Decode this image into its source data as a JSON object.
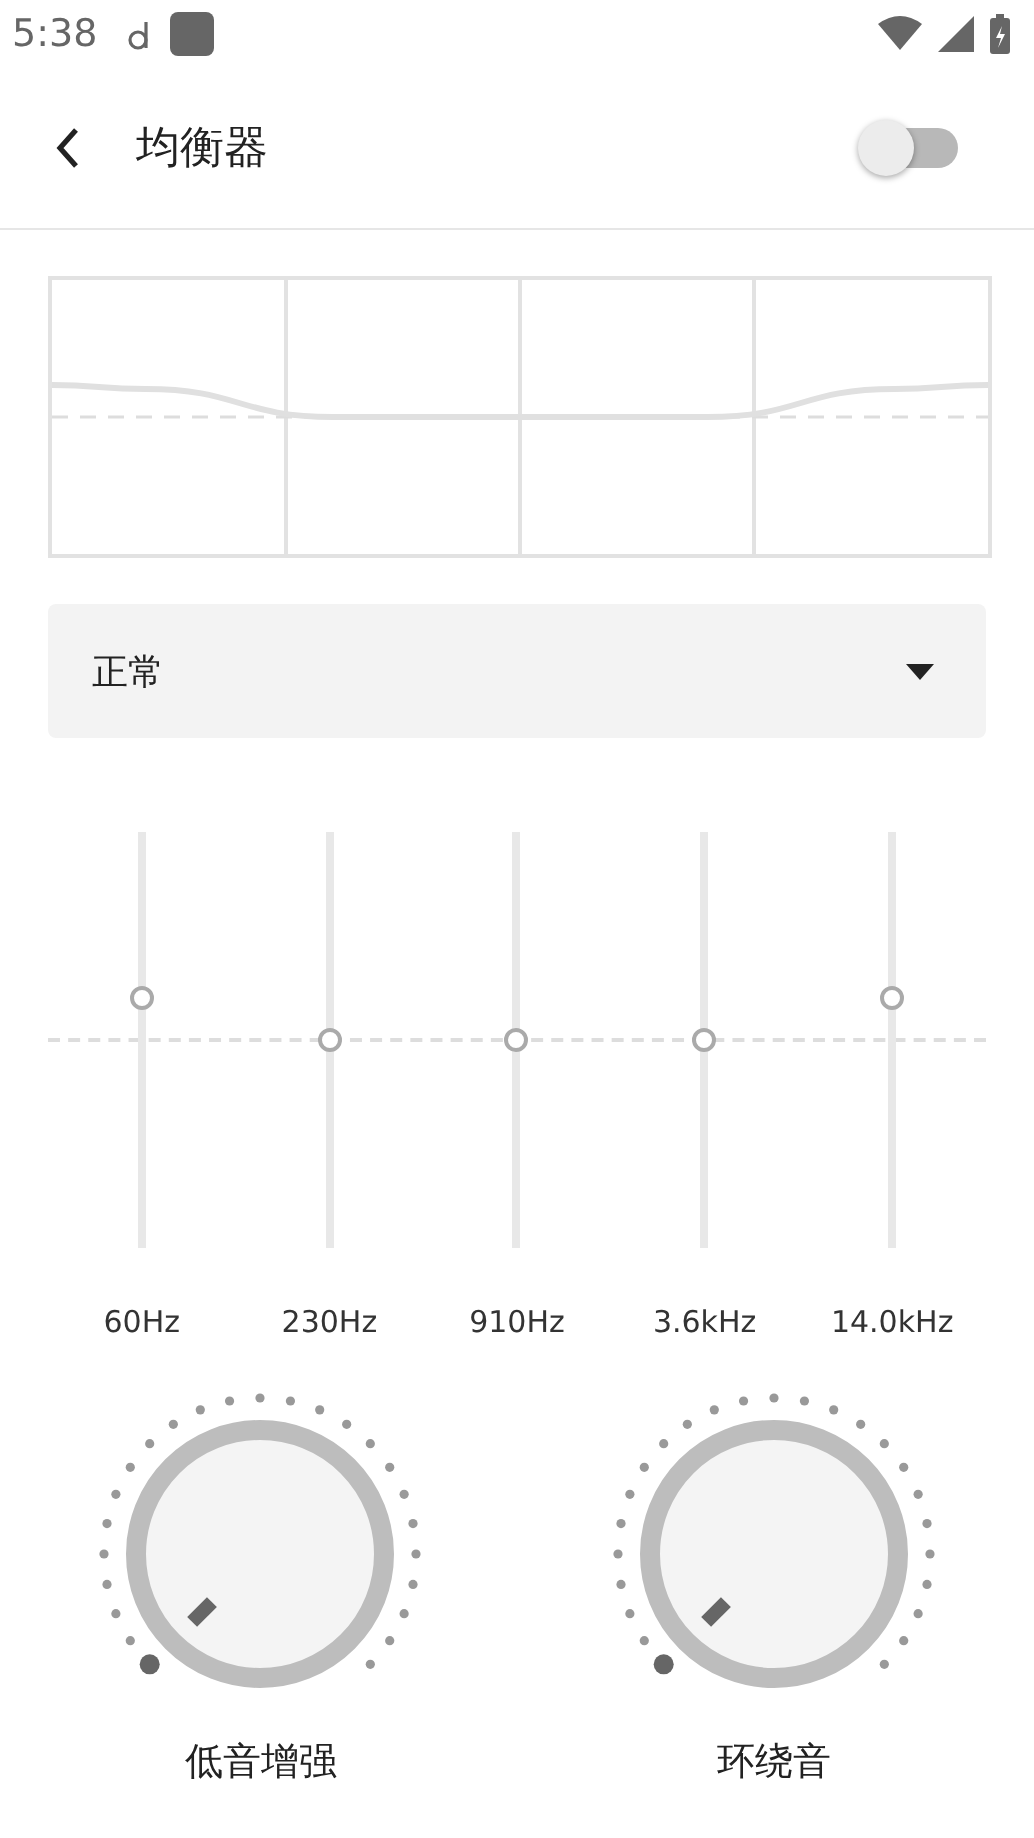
{
  "status_bar": {
    "time": "5:38"
  },
  "header": {
    "title": "均衡器",
    "switch_on": false
  },
  "preset": {
    "value": "正常"
  },
  "bands": [
    {
      "label": "60Hz",
      "level": 0.6
    },
    {
      "label": "230Hz",
      "level": 0.5
    },
    {
      "label": "910Hz",
      "level": 0.5
    },
    {
      "label": "3.6kHz",
      "level": 0.5
    },
    {
      "label": "14.0kHz",
      "level": 0.6
    }
  ],
  "knobs": [
    {
      "label": "低音增强",
      "level": 0
    },
    {
      "label": "环绕音",
      "level": 0
    }
  ]
}
